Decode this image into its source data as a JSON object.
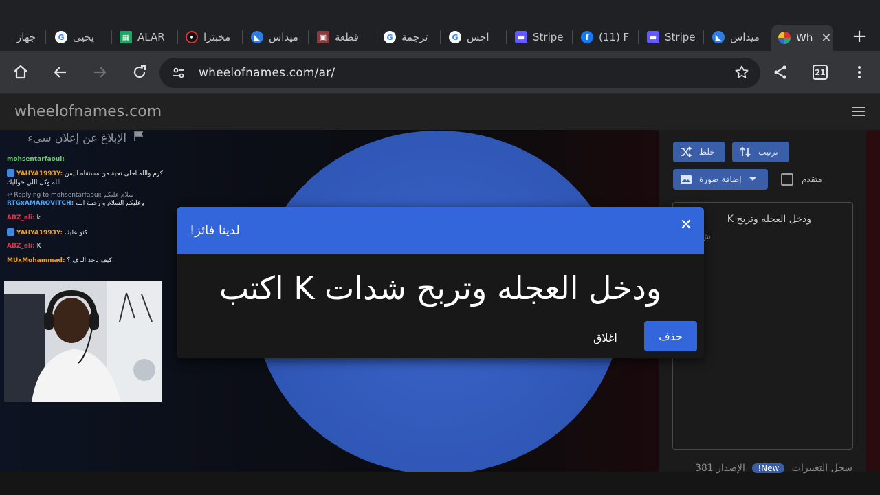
{
  "browser": {
    "tabs": [
      {
        "title": "جهاز",
        "icon": "none"
      },
      {
        "title": "يحيى",
        "icon": "google-icon"
      },
      {
        "title": "ALAR",
        "icon": "sheet-icon"
      },
      {
        "title": "مخبترا",
        "icon": "dots-icon"
      },
      {
        "title": "ميداس",
        "icon": "midas-icon"
      },
      {
        "title": "قطعة",
        "icon": "image-icon"
      },
      {
        "title": "ترجمة",
        "icon": "google-icon"
      },
      {
        "title": "احس",
        "icon": "google-icon"
      },
      {
        "title": "Stripe",
        "icon": "stripe-icon"
      },
      {
        "title": "(11) F",
        "icon": "facebook-icon"
      },
      {
        "title": "Stripe",
        "icon": "stripe-icon"
      },
      {
        "title": "ميداس",
        "icon": "midas-icon"
      },
      {
        "title": "Wh",
        "icon": "wheel-icon",
        "active": true
      }
    ],
    "new_tab": "+",
    "url": "wheelofnames.com/ar/",
    "tab_count": "21"
  },
  "site": {
    "brand": "wheelofnames.com"
  },
  "overlay": {
    "report": "الإبلاغ عن إعلان سيء",
    "chat": [
      {
        "user": "mohsentarfaoui:",
        "text": "",
        "color": "green"
      },
      {
        "user": "YAHYA1993Y:",
        "text": "كرم والله احلى تحية من مستقاه اليمن",
        "color": "orange",
        "icon": true
      },
      {
        "user": "",
        "text": "الله وكل اللي حواليك",
        "color": "none"
      },
      {
        "user": "",
        "text": "Replying to mohsentarfaoui: سلام عليكم",
        "color": "reply"
      },
      {
        "user": "RTGxAMAROVITCH:",
        "text": "وعليكم السلام و رحمة الله",
        "color": "blue"
      },
      {
        "user": "ABZ_ali:",
        "text": "k",
        "color": "red"
      },
      {
        "user": "YAHYA1993Y:",
        "text": "كتو عليك",
        "color": "orange",
        "icon": true
      },
      {
        "user": "ABZ_ali:",
        "text": "K",
        "color": "red"
      },
      {
        "user": "MUxMohammad:",
        "text": "كيف تاخذ الـ ف ؟",
        "color": "orange"
      }
    ]
  },
  "sidebar": {
    "shuffle": "خلط",
    "sort": "ترتيب",
    "add_image": "إضافة صورة",
    "advanced": "متقدم",
    "entry_text": "ودخل العجله وتربح K",
    "entry_text2": "ش",
    "footer_text": "سجل التغييرات",
    "footer_new": "New!",
    "footer_version": "الإصدار 381"
  },
  "modal": {
    "title": "لدينا فائز!",
    "winner": "ودخل العجله وتربح شدات K اكتب",
    "close_label": "اغلاق",
    "delete_label": "حذف"
  },
  "colors": {
    "primary_blue": "#3466db",
    "wheel_blue": "#3057b6",
    "chrome_dark": "#202124",
    "toolbar": "#35363a"
  }
}
